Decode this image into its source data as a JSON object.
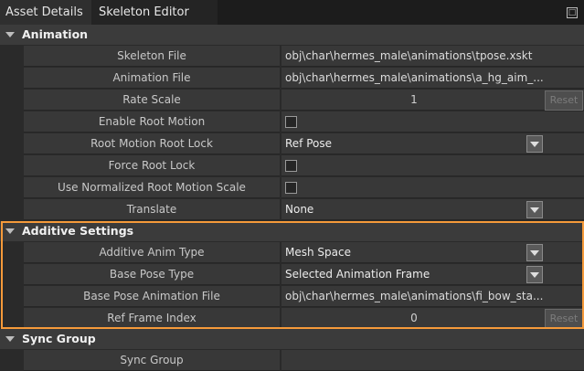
{
  "tabs": [
    {
      "label": "Asset Details"
    },
    {
      "label": "Skeleton Editor"
    }
  ],
  "sections": {
    "animation": {
      "title": "Animation",
      "rows": {
        "skeleton_file": {
          "label": "Skeleton File",
          "value": "obj\\char\\hermes_male\\animations\\tpose.xskt"
        },
        "animation_file": {
          "label": "Animation File",
          "value": "obj\\char\\hermes_male\\animations\\a_hg_aim_..."
        },
        "rate_scale": {
          "label": "Rate Scale",
          "value": "1",
          "reset": "Reset"
        },
        "enable_root_motion": {
          "label": "Enable Root Motion",
          "checked": false
        },
        "root_motion_root_lock": {
          "label": "Root Motion Root Lock",
          "value": "Ref Pose"
        },
        "force_root_lock": {
          "label": "Force Root Lock",
          "checked": false
        },
        "use_normalized": {
          "label": "Use Normalized Root Motion Scale",
          "checked": false
        },
        "translate": {
          "label": "Translate",
          "value": "None"
        }
      }
    },
    "additive": {
      "title": "Additive Settings",
      "rows": {
        "additive_anim_type": {
          "label": "Additive Anim Type",
          "value": "Mesh Space"
        },
        "base_pose_type": {
          "label": "Base Pose Type",
          "value": "Selected Animation Frame"
        },
        "base_pose_animation_file": {
          "label": "Base Pose Animation File",
          "value": "obj\\char\\hermes_male\\animations\\fi_bow_sta..."
        },
        "ref_frame_index": {
          "label": "Ref Frame Index",
          "value": "0",
          "reset": "Reset"
        }
      }
    },
    "sync": {
      "title": "Sync Group",
      "rows": {
        "sync_group": {
          "label": "Sync Group",
          "value": ""
        }
      }
    }
  },
  "colors": {
    "highlight": "#f59a3a"
  }
}
